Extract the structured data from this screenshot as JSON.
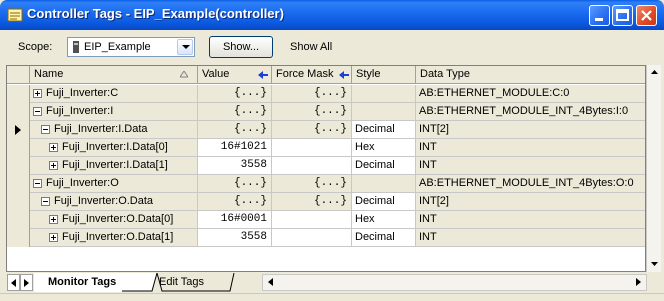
{
  "window": {
    "title": "Controller Tags - EIP_Example(controller)",
    "title_icon": "controller-tags-icon",
    "buttons": [
      "minimize",
      "maximize",
      "close"
    ]
  },
  "toolbar": {
    "scope_label": "Scope:",
    "scope_value": "EIP_Example",
    "show_button": "Show...",
    "show_all": "Show All"
  },
  "table": {
    "columns": {
      "name": "Name",
      "value": "Value",
      "force_mask": "Force Mask",
      "style": "Style",
      "data_type": "Data Type"
    },
    "rows": [
      {
        "indent": 0,
        "expander": "plus",
        "name": "Fuji_Inverter:C",
        "value": "{...}",
        "force_mask": "{...}",
        "style": "",
        "data_type": "AB:ETHERNET_MODULE:C:0",
        "current": false,
        "editable": false
      },
      {
        "indent": 0,
        "expander": "minus",
        "name": "Fuji_Inverter:I",
        "value": "{...}",
        "force_mask": "{...}",
        "style": "",
        "data_type": "AB:ETHERNET_MODULE_INT_4Bytes:I:0",
        "current": false,
        "editable": false
      },
      {
        "indent": 1,
        "expander": "minus",
        "name": "Fuji_Inverter:I.Data",
        "value": "{...}",
        "force_mask": "{...}",
        "style": "Decimal",
        "data_type": "INT[2]",
        "current": true,
        "editable": false
      },
      {
        "indent": 2,
        "expander": "plus",
        "name": "Fuji_Inverter:I.Data[0]",
        "value": "16#1021",
        "force_mask": "",
        "style": "Hex",
        "data_type": "INT",
        "current": false,
        "editable": true
      },
      {
        "indent": 2,
        "expander": "plus",
        "name": "Fuji_Inverter:I.Data[1]",
        "value": "3558",
        "force_mask": "",
        "style": "Decimal",
        "data_type": "INT",
        "current": false,
        "editable": true
      },
      {
        "indent": 0,
        "expander": "minus",
        "name": "Fuji_Inverter:O",
        "value": "{...}",
        "force_mask": "{...}",
        "style": "",
        "data_type": "AB:ETHERNET_MODULE_INT_4Bytes:O:0",
        "current": false,
        "editable": false
      },
      {
        "indent": 1,
        "expander": "minus",
        "name": "Fuji_Inverter:O.Data",
        "value": "{...}",
        "force_mask": "{...}",
        "style": "Decimal",
        "data_type": "INT[2]",
        "current": false,
        "editable": false
      },
      {
        "indent": 2,
        "expander": "plus",
        "name": "Fuji_Inverter:O.Data[0]",
        "value": "16#0001",
        "force_mask": "",
        "style": "Hex",
        "data_type": "INT",
        "current": false,
        "editable": true
      },
      {
        "indent": 2,
        "expander": "plus",
        "name": "Fuji_Inverter:O.Data[1]",
        "value": "3558",
        "force_mask": "",
        "style": "Decimal",
        "data_type": "INT",
        "current": false,
        "editable": true
      }
    ]
  },
  "tabs": [
    {
      "label": "Monitor Tags",
      "active": true
    },
    {
      "label": "Edit Tags",
      "active": false
    }
  ],
  "colors": {
    "titlebar": "#0a57dd",
    "chrome": "#ece9d8",
    "cell_white": "#ffffff"
  }
}
